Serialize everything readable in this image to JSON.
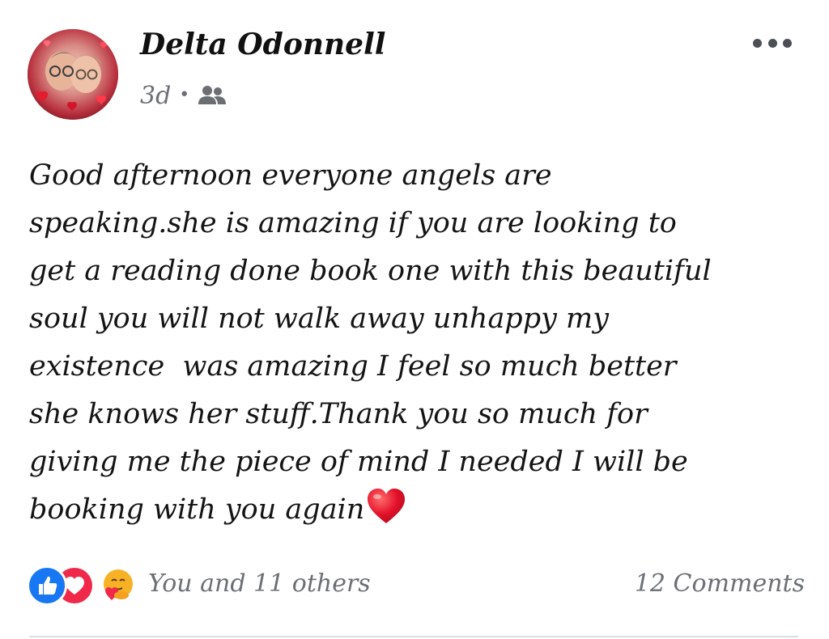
{
  "post": {
    "author_name": "Delta Odonnell",
    "time": "3d",
    "separator": "•",
    "audience_icon": "friends-icon",
    "text": "Good afternoon everyone angels are\nspeaking.she is amazing if you are looking to\nget a reading done book one with this beautiful\nsoul you will not walk away unhappy my\nexistence  was amazing I feel so much better\nshe knows her stuff.Thank you so much for\ngiving me the piece of mind I needed I will be\nbooking with you again",
    "trailing_emoji": "red-heart-icon"
  },
  "footer": {
    "reactions": [
      "like-icon",
      "love-icon",
      "care-icon"
    ],
    "reactors_label": "You and 11 others",
    "comments_label": "12 Comments"
  },
  "colors": {
    "like_blue": "#1877f2",
    "love_red": "#f0284a",
    "care_yellow": "#f7b125",
    "meta_gray": "#6b6f74"
  }
}
